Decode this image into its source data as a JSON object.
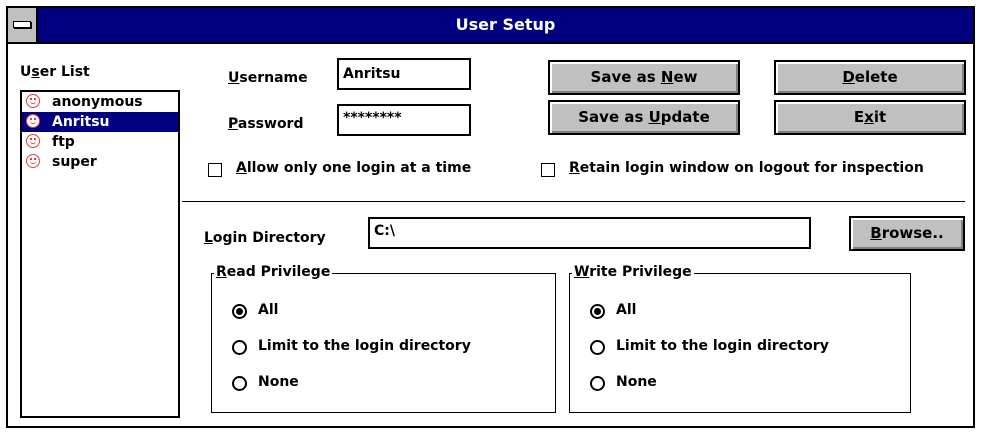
{
  "window": {
    "title": "User Setup"
  },
  "user_list": {
    "label": "User List",
    "items": [
      {
        "name": "anonymous",
        "icon": "smiley-icon",
        "selected": false
      },
      {
        "name": "Anritsu",
        "icon": "smiley-icon",
        "selected": true
      },
      {
        "name": "ftp",
        "icon": "smiley-icon",
        "selected": false
      },
      {
        "name": "super",
        "icon": "smiley-icon",
        "selected": false
      }
    ]
  },
  "form": {
    "username_label": "Username",
    "username_value": "Anritsu",
    "password_label": "Password",
    "password_value": "********",
    "login_dir_label": "Login Directory",
    "login_dir_value": "C:\\"
  },
  "buttons": {
    "save_new": "Save as New",
    "save_update": "Save as Update",
    "delete": "Delete",
    "exit": "Exit",
    "browse": "Browse.."
  },
  "options": {
    "one_login": {
      "label": "Allow only one login at a time",
      "checked": false
    },
    "retain_window": {
      "label": "Retain login window on logout for inspection",
      "checked": false
    }
  },
  "read_privilege": {
    "title": "Read Privilege",
    "options": [
      {
        "label": "All",
        "selected": true
      },
      {
        "label": "Limit to the login directory",
        "selected": false
      },
      {
        "label": "None",
        "selected": false
      }
    ]
  },
  "write_privilege": {
    "title": "Write Privilege",
    "options": [
      {
        "label": "All",
        "selected": true
      },
      {
        "label": "Limit to the login directory",
        "selected": false
      },
      {
        "label": "None",
        "selected": false
      }
    ]
  },
  "colors": {
    "title_bar": "#000080",
    "selection": "#000080",
    "icon": "#e04040",
    "button_face": "#c0c0c0"
  }
}
